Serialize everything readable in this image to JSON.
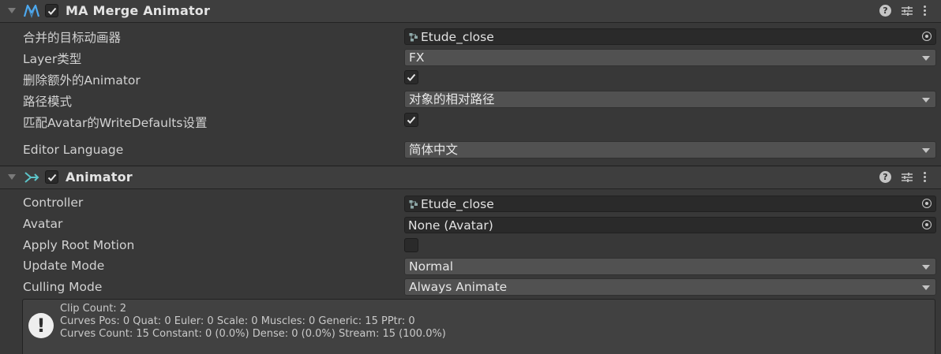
{
  "components": [
    {
      "title": "MA Merge Animator",
      "enabled": true,
      "icon": "modular-avatar-icon",
      "rows": [
        {
          "label": "合并的目标动画器",
          "kind": "object",
          "value": "Etude_close",
          "asset_icon": "animator-controller-icon"
        },
        {
          "label": "Layer类型",
          "kind": "dropdown",
          "value": "FX"
        },
        {
          "label": "删除额外的Animator",
          "kind": "toggle",
          "checked": true
        },
        {
          "label": "路径模式",
          "kind": "dropdown",
          "value": "对象的相对路径"
        },
        {
          "label": "匹配Avatar的WriteDefaults设置",
          "kind": "toggle",
          "checked": true
        },
        {
          "label": "Editor Language",
          "kind": "dropdown",
          "value": "简体中文"
        }
      ]
    },
    {
      "title": "Animator",
      "enabled": true,
      "icon": "animator-icon",
      "rows": [
        {
          "label": "Controller",
          "kind": "object",
          "value": "Etude_close",
          "asset_icon": "animator-controller-icon"
        },
        {
          "label": "Avatar",
          "kind": "object",
          "value": "None (Avatar)"
        },
        {
          "label": "Apply Root Motion",
          "kind": "toggle",
          "checked": false
        },
        {
          "label": "Update Mode",
          "kind": "dropdown",
          "value": "Normal"
        },
        {
          "label": "Culling Mode",
          "kind": "dropdown",
          "value": "Always Animate"
        }
      ],
      "info": {
        "icon": "warning-icon",
        "glyph": "!",
        "lines": [
          "Clip Count: 2",
          "Curves Pos: 0 Quat: 0 Euler: 0 Scale: 0 Muscles: 0 Generic: 15 PPtr: 0",
          "Curves Count: 15 Constant: 0 (0.0%) Dense: 0 (0.0%) Stream: 15 (100.0%)"
        ]
      }
    }
  ],
  "header_icons": {
    "help": "?",
    "help_icon": "help-icon",
    "preset_icon": "preset-icon",
    "menu_icon": "context-menu-icon"
  },
  "colors": {
    "background": "#383838",
    "header": "#3e3e3e",
    "field": "#2a2a2a",
    "dropdown": "#515151",
    "accent_icon": "#4da9f0",
    "animator_icon": "#5cc4c9"
  }
}
